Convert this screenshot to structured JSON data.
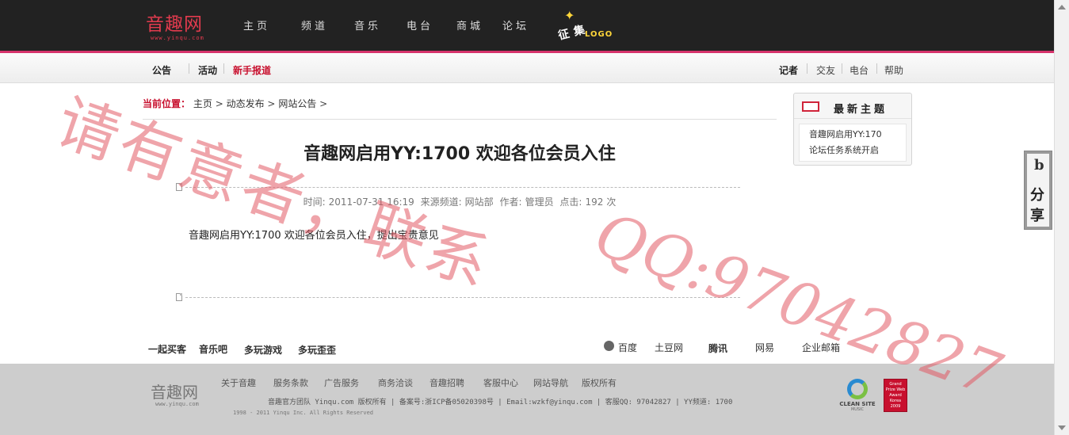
{
  "header": {
    "logo": {
      "cn": "音趣网",
      "en": "www.yinqu.com"
    },
    "nav": [
      "主页",
      "频道",
      "音乐",
      "电台",
      "商城",
      "论坛"
    ],
    "badge": {
      "text": "征集",
      "logo": "LOGO"
    }
  },
  "subnav": {
    "left": [
      "公告",
      "活动",
      "新手报道"
    ],
    "right": [
      "记者",
      "交友",
      "电台",
      "帮助"
    ]
  },
  "breadcrumb": {
    "label": "当前位置：",
    "items": [
      "主页",
      "动态发布",
      "网站公告"
    ],
    "separator": ">"
  },
  "article": {
    "title": "音趣网启用YY:1700 欢迎各位会员入住",
    "meta": {
      "time_label": "时间:",
      "time": "2011-07-31 16:19",
      "source_label": "来源频道:",
      "source": "网站部",
      "author_label": "作者:",
      "author": "管理员",
      "clicks_label": "点击:",
      "clicks": "192",
      "clicks_unit": "次"
    },
    "body": "音趣网启用YY:1700 欢迎各位会员入住，提出宝贵意见"
  },
  "sidebar": {
    "title": "最新主题",
    "items": [
      "音趣网启用YY:170",
      "论坛任务系统开启"
    ]
  },
  "share": {
    "icon": "b",
    "label1": "分",
    "label2": "享"
  },
  "friend_links": {
    "left": [
      "一起买客",
      "音乐吧",
      "多玩游戏",
      "多玩歪歪"
    ],
    "right": [
      "百度",
      "土豆网",
      "腾讯",
      "网易",
      "企业邮箱"
    ]
  },
  "footer": {
    "logo": {
      "cn": "音趣网",
      "en": "www.yinqu.com"
    },
    "links": [
      "关于音趣",
      "服务条款",
      "广告服务",
      "商务洽谈",
      "音趣招聘",
      "客服中心",
      "网站导航",
      "版权所有"
    ],
    "info": "音趣官方团队  Yinqu.com 版权所有 | 备案号:浙ICP备05020398号 | Email:wzkf@yinqu.com | 客服QQ: 97042827 | YY频道: 1700",
    "copyright": "1998 - 2011 Yinqu Inc. All Rights Reserved",
    "badges": {
      "clean": "CLEAN SITE",
      "clean_sub": "MUSIC",
      "award": "Grand Prize Web Award Korea 2009"
    }
  },
  "watermark": {
    "line1": "请有意者，联系",
    "line2": "QQ:97042827"
  },
  "colors": {
    "brand": "#e23b4e",
    "accent": "#d6336c",
    "topbar": "#222222",
    "footer": "#cdcdcd"
  }
}
